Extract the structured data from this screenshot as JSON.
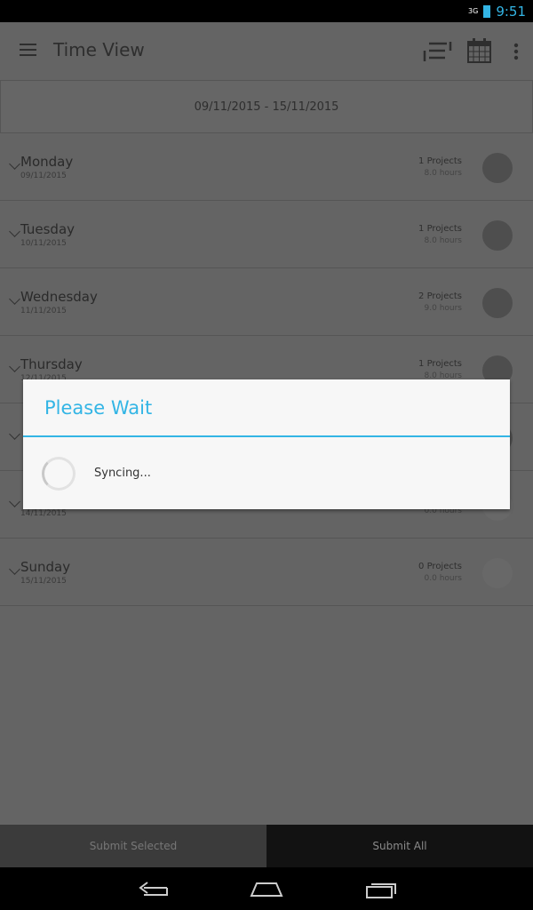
{
  "status": {
    "network": "3G",
    "time": "9:51"
  },
  "appbar": {
    "title": "Time View",
    "icons": [
      "menu-icon",
      "sort-icon",
      "calendar-icon",
      "overflow-icon"
    ]
  },
  "range": "09/11/2015 - 15/11/2015",
  "days": [
    {
      "name": "Monday",
      "date": "09/11/2015",
      "projects": "1 Projects",
      "hours": "8.0 hours",
      "filled": true
    },
    {
      "name": "Tuesday",
      "date": "10/11/2015",
      "projects": "1 Projects",
      "hours": "8.0 hours",
      "filled": true
    },
    {
      "name": "Wednesday",
      "date": "11/11/2015",
      "projects": "2 Projects",
      "hours": "9.0 hours",
      "filled": true
    },
    {
      "name": "Thursday",
      "date": "12/11/2015",
      "projects": "1 Projects",
      "hours": "8.0 hours",
      "filled": true
    },
    {
      "name": "",
      "date": "",
      "projects": "",
      "hours": "",
      "filled": true
    },
    {
      "name": "",
      "date": "14/11/2015",
      "projects": "",
      "hours": "0.0 hours",
      "filled": false
    },
    {
      "name": "Sunday",
      "date": "15/11/2015",
      "projects": "0 Projects",
      "hours": "0.0 hours",
      "filled": false
    }
  ],
  "dialog": {
    "title": "Please Wait",
    "message": "Syncing..."
  },
  "footer": {
    "submit_selected": "Submit Selected",
    "submit_all": "Submit All"
  },
  "colors": {
    "accent": "#33b5e5"
  }
}
